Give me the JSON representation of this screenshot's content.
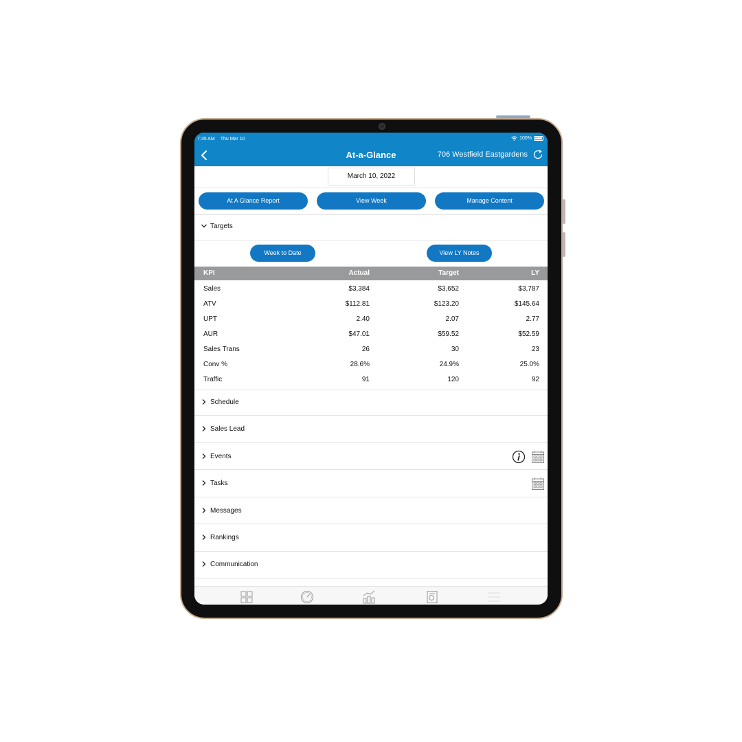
{
  "status": {
    "time": "7:35 AM",
    "date": "Thu Mar 10",
    "battery": "100%"
  },
  "header": {
    "title": "At-a-Glance",
    "store": "706 Westfield Eastgardens"
  },
  "date": "March 10, 2022",
  "actions": {
    "glance_report": "At A Glance Report",
    "view_week": "View Week",
    "manage_content": "Manage Content"
  },
  "targets": {
    "label": "Targets",
    "week_to_date": "Week to Date",
    "view_ly_notes": "View LY Notes",
    "columns": [
      "KPI",
      "Actual",
      "Target",
      "LY"
    ],
    "rows": [
      [
        "Sales",
        "$3,384",
        "$3,652",
        "$3,787"
      ],
      [
        "ATV",
        "$112.81",
        "$123.20",
        "$145.64"
      ],
      [
        "UPT",
        "2.40",
        "2.07",
        "2.77"
      ],
      [
        "AUR",
        "$47.01",
        "$59.52",
        "$52.59"
      ],
      [
        "Sales Trans",
        "26",
        "30",
        "23"
      ],
      [
        "Conv %",
        "28.6%",
        "24.9%",
        "25.0%"
      ],
      [
        "Traffic",
        "91",
        "120",
        "92"
      ]
    ]
  },
  "sections": [
    "Schedule",
    "Sales Lead",
    "Events",
    "Tasks",
    "Messages",
    "Rankings",
    "Communication"
  ],
  "colors": {
    "accent": "#1085c8",
    "button": "#1278c4",
    "table_header": "#999a9c"
  },
  "tabbar": {
    "icons": [
      "dashboard-icon",
      "gauge-icon",
      "chart-icon",
      "report-icon",
      "menu-icon"
    ]
  }
}
